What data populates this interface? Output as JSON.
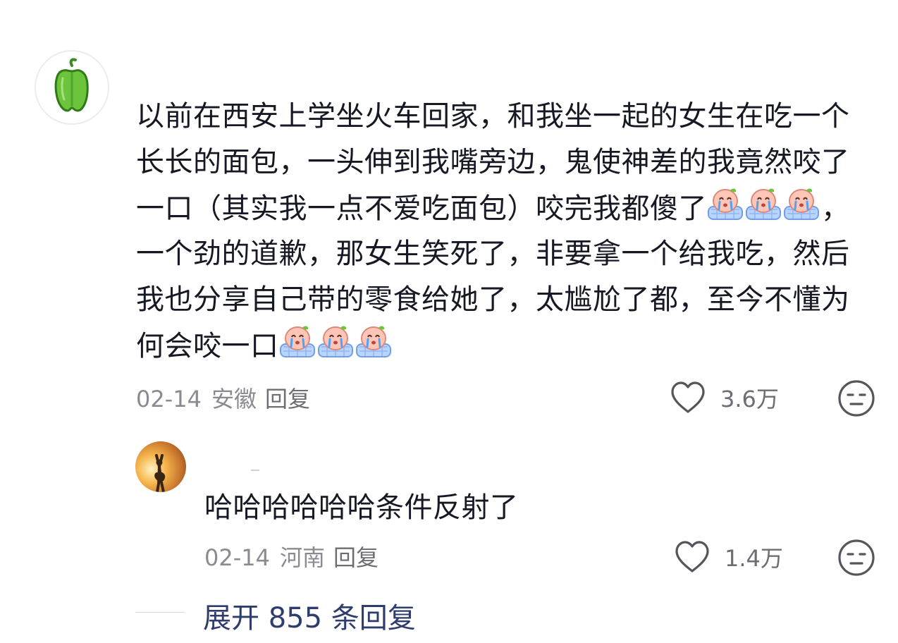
{
  "main_comment": {
    "lines": [
      "以前在西安上学坐火车回家，和我坐一起的女生在吃一个",
      "长长的面包，一头伸到我嘴旁边，鬼使神差的我竟然咬了",
      "一口（其实我一点不爱吃面包）咬完我都傻了",
      "，",
      "一个劲的道歉，那女生笑死了，非要拿一个给我吃，然后",
      "我也分享自己带的零食给她了，太尴尬了都，至今不懂为",
      "何会咬一口"
    ],
    "date": "02-14",
    "location": "安徽",
    "reply_label": "回复",
    "like_count": "3.6万",
    "emoji_name": "crying-emoji"
  },
  "reply_comment": {
    "text": "哈哈哈哈哈哈条件反射了",
    "date": "02-14",
    "location": "河南",
    "reply_label": "回复",
    "like_count": "1.4万"
  },
  "expand": {
    "label": "展开 855 条回复"
  },
  "icons": {
    "main_avatar": "green-pepper-icon",
    "like": "heart-outline-icon",
    "reaction": "neutral-face-icon"
  },
  "colors": {
    "text": "#161823",
    "meta": "#8a8b91",
    "link": "#2f3d6e",
    "pepper": "#6cc43c"
  }
}
